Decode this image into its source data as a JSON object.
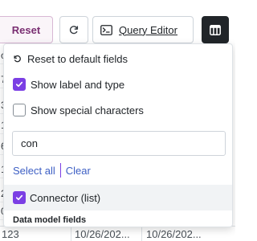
{
  "toolbar": {
    "reset_label": "Reset",
    "refresh_icon": "refresh-icon",
    "query_editor_icon": "terminal-icon",
    "query_editor_label": "Query Editor",
    "table_icon": "table-icon"
  },
  "dropdown": {
    "reset_fields_label": "Reset to default fields",
    "show_label_and_type": {
      "label": "Show label and type",
      "checked": true
    },
    "show_special_characters": {
      "label": "Show special characters",
      "checked": false
    },
    "search": {
      "value": "con",
      "placeholder": ""
    },
    "select_all_label": "Select all",
    "clear_label": "Clear",
    "items": [
      {
        "label": "Connector (list)",
        "checked": true
      }
    ],
    "section_header": "Data model fields"
  },
  "table": {
    "edge_glyphs": [
      "c",
      "7",
      "3",
      "1",
      "6",
      "1",
      "2",
      "0"
    ],
    "bottom_row": [
      "123",
      "10/26/202...",
      "10/26/202..."
    ]
  },
  "colors": {
    "accent_purple": "#7b3fe4",
    "reset_text": "#7a2f72",
    "link_blue": "#3d5fc4",
    "dark_button": "#212529"
  }
}
